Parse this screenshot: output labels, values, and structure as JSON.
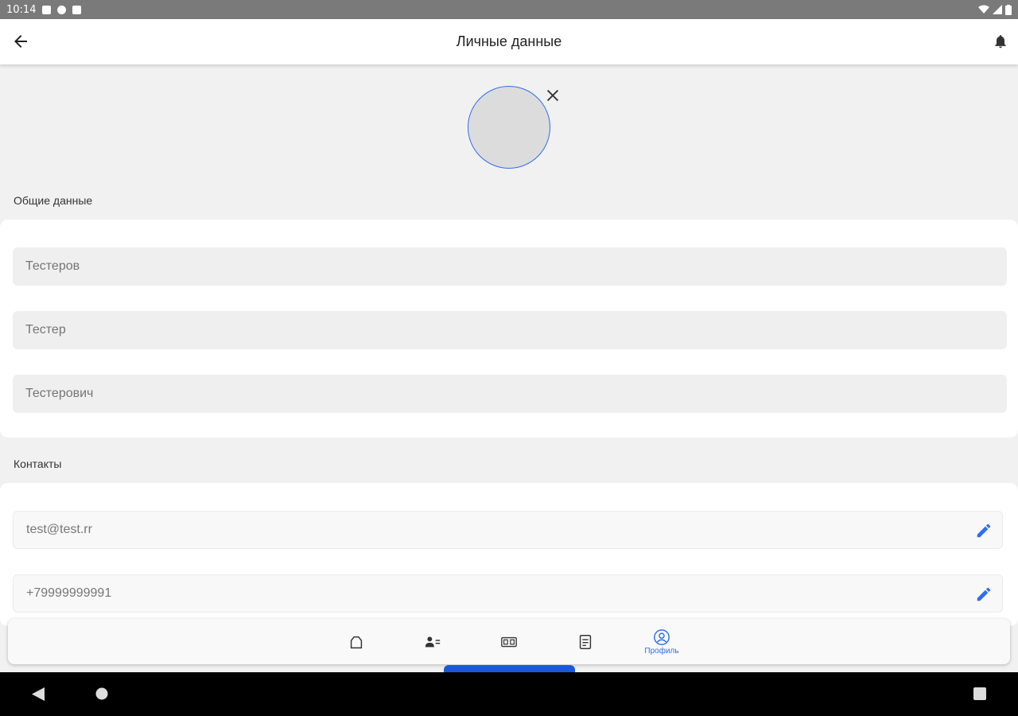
{
  "status_bar": {
    "time": "10:14"
  },
  "app_bar": {
    "title": "Личные данные"
  },
  "general_section": {
    "label": "Общие данные",
    "fields": [
      {
        "placeholder": "Тестеров"
      },
      {
        "placeholder": "Тестер"
      },
      {
        "placeholder": "Тестерович"
      }
    ]
  },
  "contacts_section": {
    "label": "Контакты",
    "fields": [
      {
        "value": "test@test.rr"
      },
      {
        "value": "+79999999991"
      }
    ]
  },
  "bottom_nav": {
    "items": [
      {
        "icon": "home-icon",
        "label": ""
      },
      {
        "icon": "contacts-icon",
        "label": ""
      },
      {
        "icon": "ticket-icon",
        "label": ""
      },
      {
        "icon": "document-icon",
        "label": ""
      },
      {
        "icon": "profile-icon",
        "label": "Профиль"
      }
    ],
    "active_index": 4
  },
  "colors": {
    "accent": "#2f6ef0",
    "indicator": "#1a5ad9",
    "background": "#f1f1f1"
  }
}
